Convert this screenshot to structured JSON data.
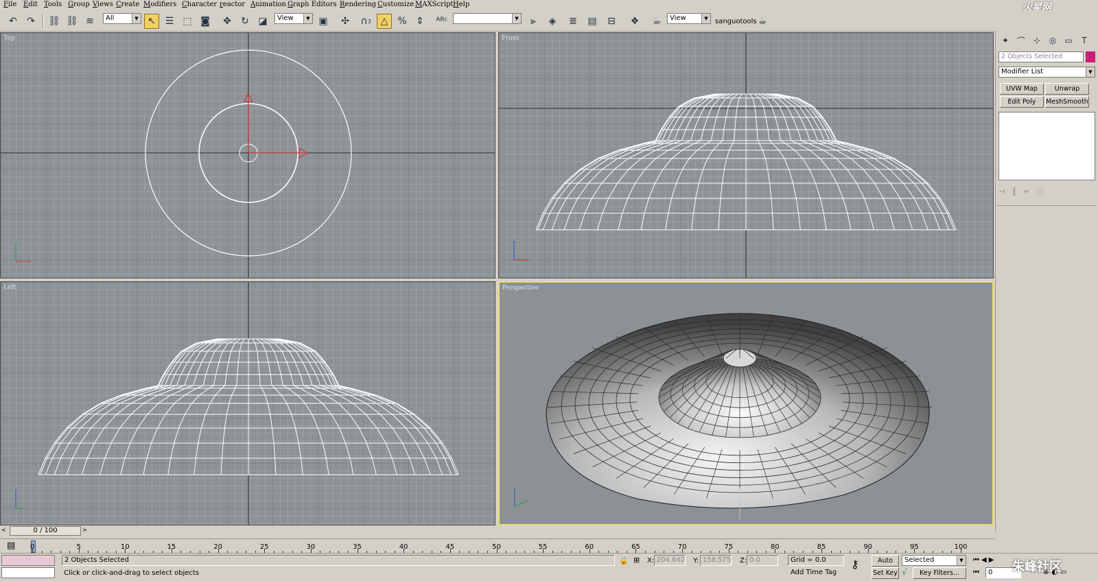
{
  "menu": [
    "File",
    "Edit",
    "Tools",
    "Group",
    "Views",
    "Create",
    "Modifiers",
    "Character",
    "reactor",
    "Animation",
    "Graph Editors",
    "Rendering",
    "Customize",
    "MAXScript",
    "Help"
  ],
  "brand": "火星网",
  "toolbar": {
    "selection_filter": "All",
    "ref_coord_1": "View",
    "named_selection": "",
    "ref_coord_2": "View",
    "user_label": "sanguotools",
    "snap_label": "3"
  },
  "viewports": {
    "top": "Top",
    "front": "Front",
    "left": "Left",
    "perspective": "Perspective"
  },
  "command_panel": {
    "object_name": "2 Objects Selected",
    "object_color": "#c8207a",
    "modifier_list": "Modifier List",
    "buttons": [
      "UVW Map",
      "Unwrap UVW",
      "Edit Poly",
      "MeshSmooth"
    ]
  },
  "timeline": {
    "frame_display": "0 / 100",
    "ticks": [
      "0",
      "5",
      "10",
      "15",
      "20",
      "25",
      "30",
      "35",
      "40",
      "45",
      "50",
      "55",
      "60",
      "65",
      "70",
      "75",
      "80",
      "85",
      "90",
      "95",
      "100"
    ]
  },
  "status": {
    "selection_info": "2 Objects Selected",
    "prompt": "Click or click-and-drag to select objects",
    "x_label": "X:",
    "x_value": "204.642",
    "y_label": "Y:",
    "y_value": "158.575",
    "z_label": "Z:",
    "z_value": "0.0",
    "grid": "Grid = 0.0",
    "add_time_tag": "Add Time Tag",
    "auto_key": "Auto Key",
    "set_key": "Set Key",
    "key_mode": "Selected",
    "key_filters": "Key Filters...",
    "frame_field": "0",
    "watermark": "朱峰社区"
  },
  "colors": {
    "ui_bg": "#d4d0c8",
    "viewport_bg": "#8c9296",
    "active_border": "#e8e070",
    "wire": "#ffffff"
  }
}
